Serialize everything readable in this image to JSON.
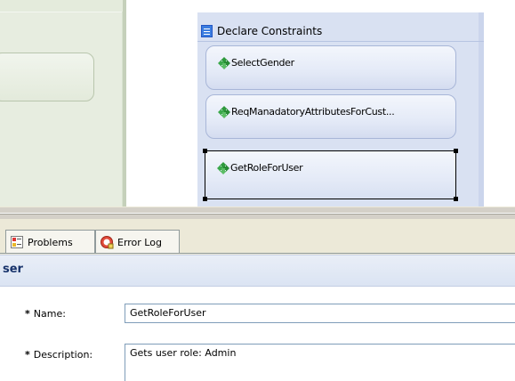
{
  "diagram": {
    "constraints_title": "Declare Constraints",
    "constraints_icon": "constraints-list-icon",
    "nodes": [
      {
        "label": "SelectGender",
        "icon": "rule-arrows-icon",
        "selected": false
      },
      {
        "label": "ReqManadatoryAttributesForCust...",
        "icon": "rule-arrows-icon",
        "selected": false
      },
      {
        "label": "GetRoleForUser",
        "icon": "rule-arrows-icon",
        "selected": true
      }
    ]
  },
  "tabs": [
    {
      "label": "Problems",
      "icon": "problems-icon"
    },
    {
      "label": "Error Log",
      "icon": "error-log-icon"
    }
  ],
  "properties": {
    "title": "ser",
    "name_required_mark": "*",
    "name_label": "Name:",
    "name_value": "GetRoleForUser",
    "description_required_mark": "*",
    "description_label": "Description:",
    "description_value": "Gets user role: Admin"
  },
  "colors": {
    "constraints_bg": "#d9e1f2",
    "node_border": "#a8b6d8",
    "props_title": "#18336b",
    "rule_icon_green": "#2e9a3c"
  }
}
